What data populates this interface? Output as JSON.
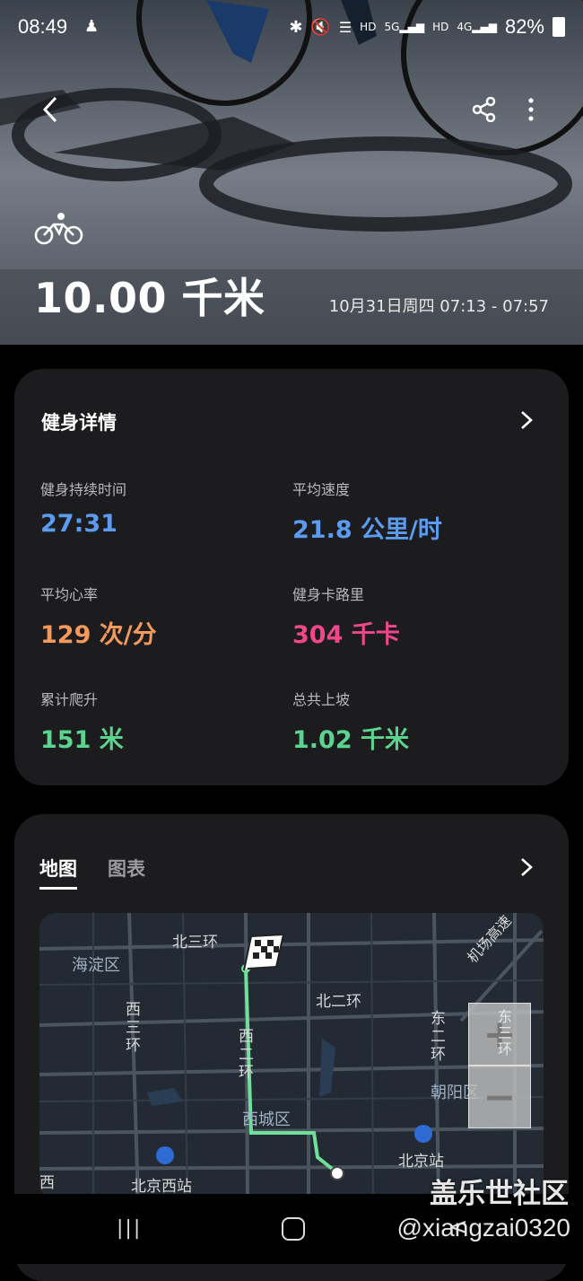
{
  "status_bar": {
    "time": "08:49",
    "hd1": "HD",
    "hd2": "HD",
    "net1": "5G",
    "net2": "4G",
    "battery": "82%"
  },
  "header": {
    "activity_icon": "bicycle-icon",
    "distance": "10.00 千米",
    "date_range": "10月31日周四 07:13 - 07:57"
  },
  "details": {
    "title": "健身详情",
    "metrics": [
      {
        "label": "健身持续时间",
        "value": "27:31",
        "color": "#5b9bf0"
      },
      {
        "label": "平均速度",
        "value": "21.8 公里/时",
        "color": "#5b9bf0"
      },
      {
        "label": "平均心率",
        "value": "129 次/分",
        "color": "#f39a5c"
      },
      {
        "label": "健身卡路里",
        "value": "304 千卡",
        "color": "#f2478a"
      },
      {
        "label": "累计爬升",
        "value": "151 米",
        "color": "#5ad48e"
      },
      {
        "label": "总共上坡",
        "value": "1.02 千米",
        "color": "#5ad48e"
      }
    ]
  },
  "map_card": {
    "tabs": [
      {
        "label": "地图"
      },
      {
        "label": "图表"
      }
    ],
    "labels": {
      "haidian": "海淀区",
      "bei3": "北三环",
      "bei2": "北二环",
      "jichang": "机场高速",
      "xi3": "西三环",
      "xi2": "西二环",
      "dong2": "东二环",
      "dong3": "东三环",
      "chaoyang": "朝阳区",
      "xicheng": "西城区",
      "beijingxi": "北京西站",
      "beijing": "北京站",
      "xi_partial": "西"
    },
    "zoom_in": "+",
    "zoom_out": "−",
    "route_color": "#6fe09a"
  },
  "navbar": {
    "recent": "|||",
    "back": "<"
  },
  "watermark": {
    "line1": "盖乐世社区",
    "line2": "@xiangzai0320"
  }
}
